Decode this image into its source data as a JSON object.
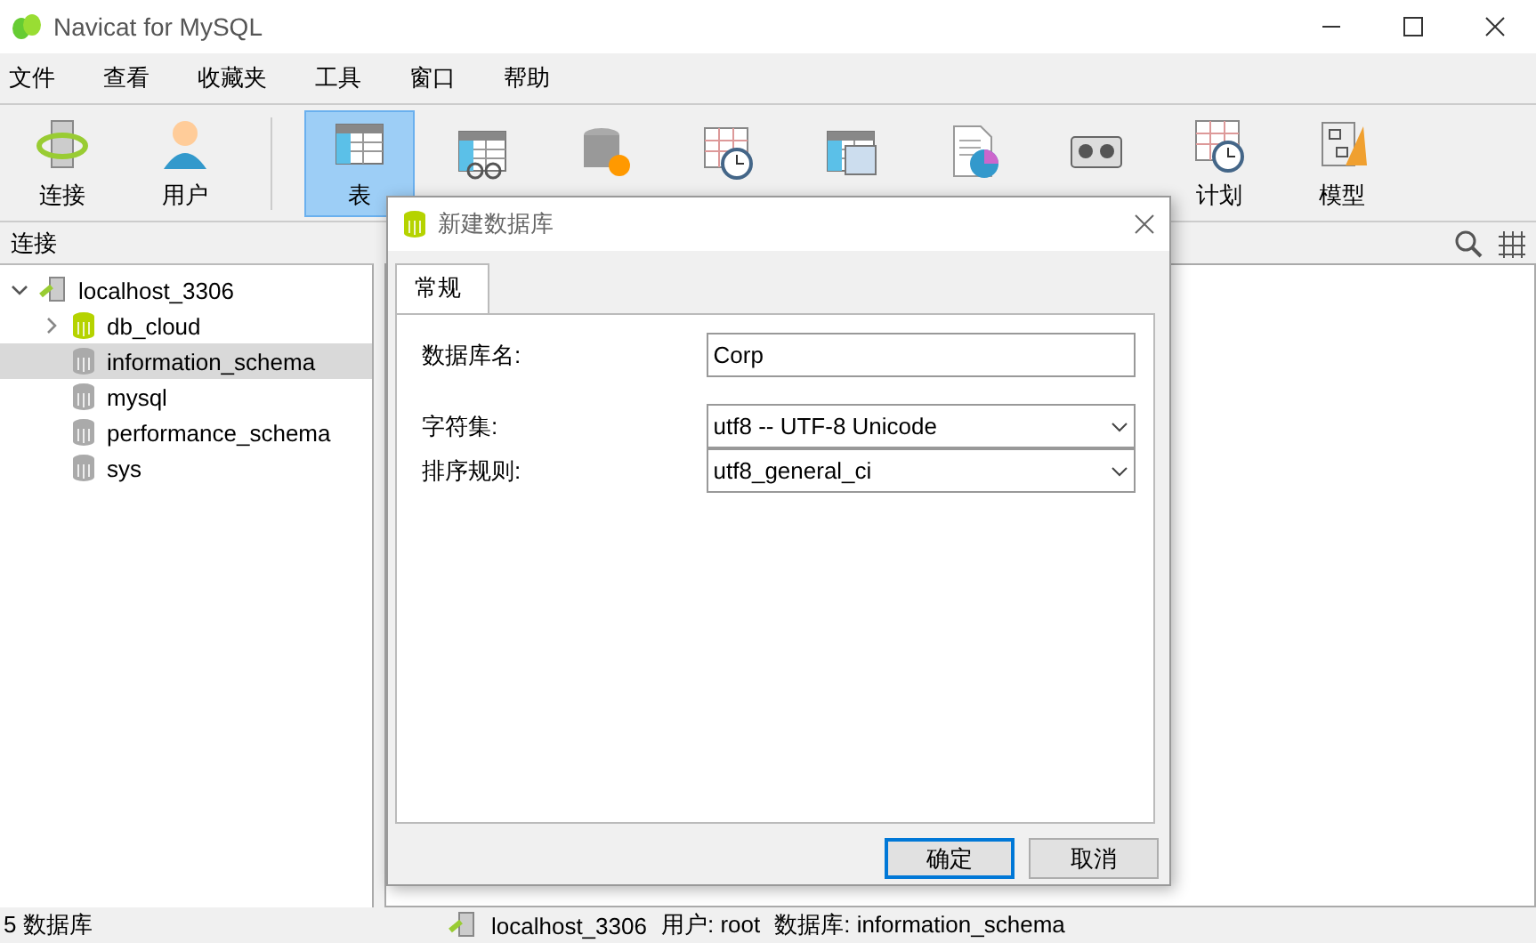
{
  "window": {
    "title": "Navicat for MySQL"
  },
  "menu": [
    "文件",
    "查看",
    "收藏夹",
    "工具",
    "窗口",
    "帮助"
  ],
  "toolbar": [
    {
      "label": "连接",
      "kind": "connect",
      "selected": false
    },
    {
      "label": "用户",
      "kind": "user",
      "selected": false
    },
    {
      "label": "表",
      "kind": "table",
      "selected": true
    },
    {
      "kind": "view",
      "selected": false
    },
    {
      "kind": "function",
      "selected": false
    },
    {
      "kind": "event",
      "selected": false
    },
    {
      "kind": "query",
      "selected": false
    },
    {
      "kind": "report",
      "selected": false
    },
    {
      "kind": "backup",
      "selected": false
    },
    {
      "label": "计划",
      "kind": "schedule",
      "selected": false
    },
    {
      "label": "模型",
      "kind": "model",
      "selected": false
    }
  ],
  "sidebar": {
    "title": "连接",
    "tree": [
      {
        "label": "localhost_3306",
        "kind": "server",
        "expanded": true,
        "selected": false,
        "children": [
          {
            "label": "db_cloud",
            "kind": "db",
            "open": true,
            "selected": false
          },
          {
            "label": "information_schema",
            "kind": "db",
            "open": false,
            "selected": true
          },
          {
            "label": "mysql",
            "kind": "db",
            "open": false,
            "selected": false
          },
          {
            "label": "performance_schema",
            "kind": "db",
            "open": false,
            "selected": false
          },
          {
            "label": "sys",
            "kind": "db",
            "open": false,
            "selected": false
          }
        ]
      }
    ]
  },
  "dialog": {
    "title": "新建数据库",
    "tabs": [
      {
        "label": "常规",
        "selected": true
      }
    ],
    "fields": [
      {
        "label": "数据库名:",
        "kind": "text",
        "value": "Corp"
      },
      {
        "label": "字符集:",
        "kind": "select",
        "value": "utf8 -- UTF-8 Unicode"
      },
      {
        "label": "排序规则:",
        "kind": "select",
        "value": "utf8_general_ci"
      }
    ],
    "buttons": [
      {
        "label": "确定",
        "selected": true
      },
      {
        "label": "取消",
        "selected": false
      }
    ]
  },
  "status_bar": {
    "count": "5 数据库",
    "connection": "localhost_3306",
    "user": "用户: root",
    "database": "数据库: information_schema"
  }
}
